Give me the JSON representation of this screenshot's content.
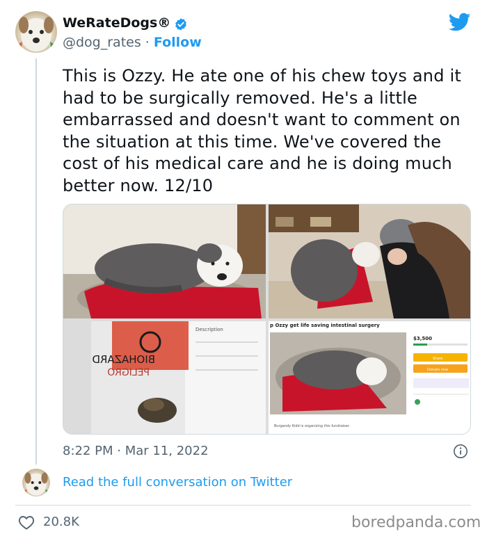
{
  "author": {
    "display_name": "WeRateDogs®",
    "handle": "@dog_rates",
    "separator": " · ",
    "follow_label": "Follow",
    "avatar_icon": "dog-avatar-icon",
    "verified_icon": "verified-badge-icon"
  },
  "brand": {
    "icon": "twitter-bird-icon",
    "color": "#1d9bf0"
  },
  "tweet": {
    "text": "This is Ozzy. He ate one of his chew toys and it had to be surgically removed. He's a little embarrassed and doesn't want to comment on the situation at this time. We've covered the cost of his medical care and he is doing much better now. 12/10",
    "timestamp": "8:22 PM · Mar 11, 2022"
  },
  "media": {
    "photos": [
      {
        "name": "dog-on-red-bed-photo"
      },
      {
        "name": "dog-hugging-woman-photo"
      },
      {
        "name": "biohazard-bag-photo",
        "bag_text_1": "BIOHAZARD",
        "bag_text_2": "PELIGRO",
        "form_label": "Description"
      },
      {
        "name": "fundraiser-screenshot",
        "title": "p Ozzy get life saving intestinal surgery",
        "amount": "$3,500",
        "share_label": "Share",
        "donate_label": "Donate now",
        "organizer_text": "Burgandy Kidd is organizing this fundraiser."
      }
    ]
  },
  "conversation": {
    "link_text": "Read the full conversation on Twitter"
  },
  "footer": {
    "likes": "20.8K",
    "watermark": "boredpanda.com"
  },
  "colors": {
    "link": "#1d9bf0",
    "secondary_text": "#536471",
    "border": "#cfd9de"
  }
}
